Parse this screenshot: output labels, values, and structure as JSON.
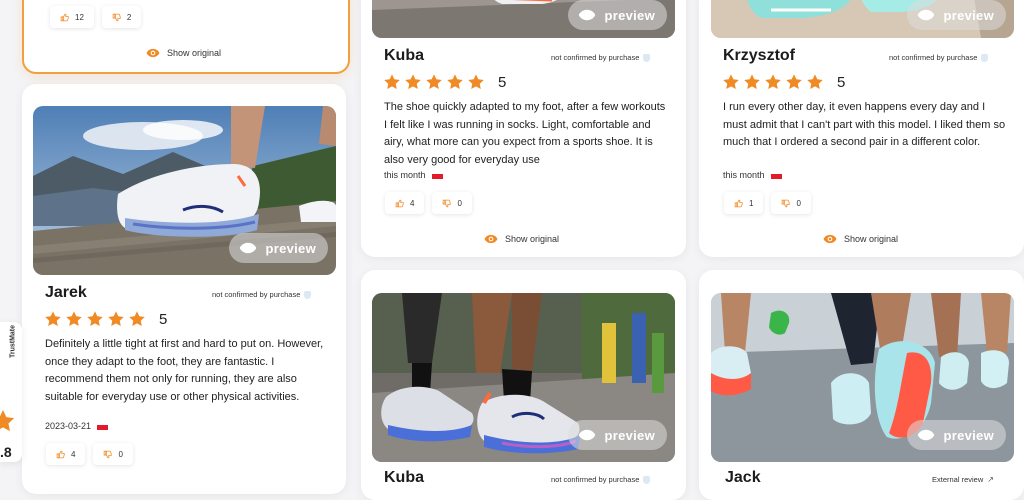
{
  "colors": {
    "accent": "#f08a24",
    "star": "#f08a24",
    "flag_red": "#e21b2b"
  },
  "common": {
    "preview_label": "preview",
    "show_original_label": "Show original",
    "not_confirmed_label": "not confirmed by purchase",
    "external_review_label": "External review"
  },
  "top_left_card": {
    "likes": "12",
    "dislikes": "2"
  },
  "reviews": [
    {
      "name": "Jarek",
      "rating": "5",
      "text": "Definitely a little tight at first and hard to put on. However, once they adapt to the foot, they are fantastic. I recommend them not only for running, they are also suitable for everyday use or other physical activities.",
      "date": "2023-03-21",
      "likes": "4",
      "dislikes": "0"
    },
    {
      "name": "Kuba",
      "rating": "5",
      "text": "The shoe quickly adapted to my foot, after a few workouts I felt like I was running in socks. Light, comfortable and airy, what more can you expect from a sports shoe. It is also very good for everyday use",
      "date": "this month",
      "likes": "4",
      "dislikes": "0"
    },
    {
      "name": "Krzysztof",
      "rating": "5",
      "text": "I run every other day, it even happens every day and I must admit that I can't part with this model. I liked them so much that I ordered a second pair in a different color.",
      "date": "this month",
      "likes": "1",
      "dislikes": "0"
    },
    {
      "name": "Kuba"
    },
    {
      "name": "Jack"
    }
  ],
  "trustmate": {
    "label": "TrustMate",
    "score": ".8"
  },
  "icons": [
    "eye-icon",
    "star-icon",
    "thumbs-up-icon",
    "thumbs-down-icon",
    "shield-icon",
    "flag-icon",
    "external-link-icon"
  ]
}
